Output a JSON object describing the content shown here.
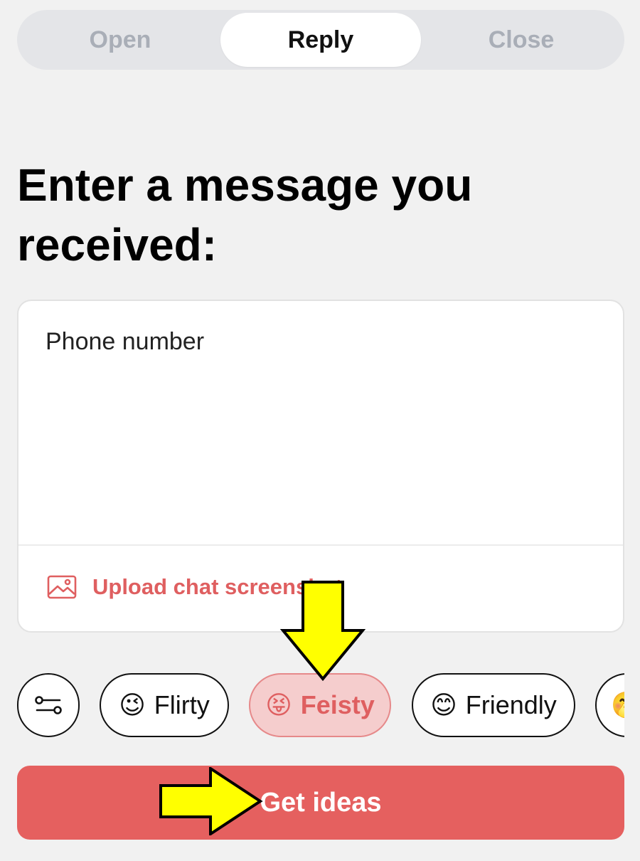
{
  "tabs": [
    {
      "label": "Open",
      "active": false
    },
    {
      "label": "Reply",
      "active": true
    },
    {
      "label": "Close",
      "active": false
    }
  ],
  "heading": "Enter a message you received:",
  "message_input": {
    "placeholder": "Phone number",
    "value": "Phone number"
  },
  "upload": {
    "label": "Upload chat screenshot",
    "icon": "image-icon"
  },
  "tone_chips": [
    {
      "label": "Flirty",
      "emoji": "😉",
      "selected": false
    },
    {
      "label": "Feisty",
      "emoji": "😝",
      "selected": true
    },
    {
      "label": "Friendly",
      "emoji": "😊",
      "selected": false
    },
    {
      "label": "",
      "emoji": "🤭",
      "selected": false
    }
  ],
  "filter_icon": "sliders-icon",
  "cta": {
    "label": "Get ideas"
  },
  "colors": {
    "accent": "#e5605f",
    "accent_text": "#df5f60",
    "selected_chip_bg": "#f5cdcd",
    "background": "#f1f1f1",
    "annotation_arrow": "#ffff00"
  }
}
